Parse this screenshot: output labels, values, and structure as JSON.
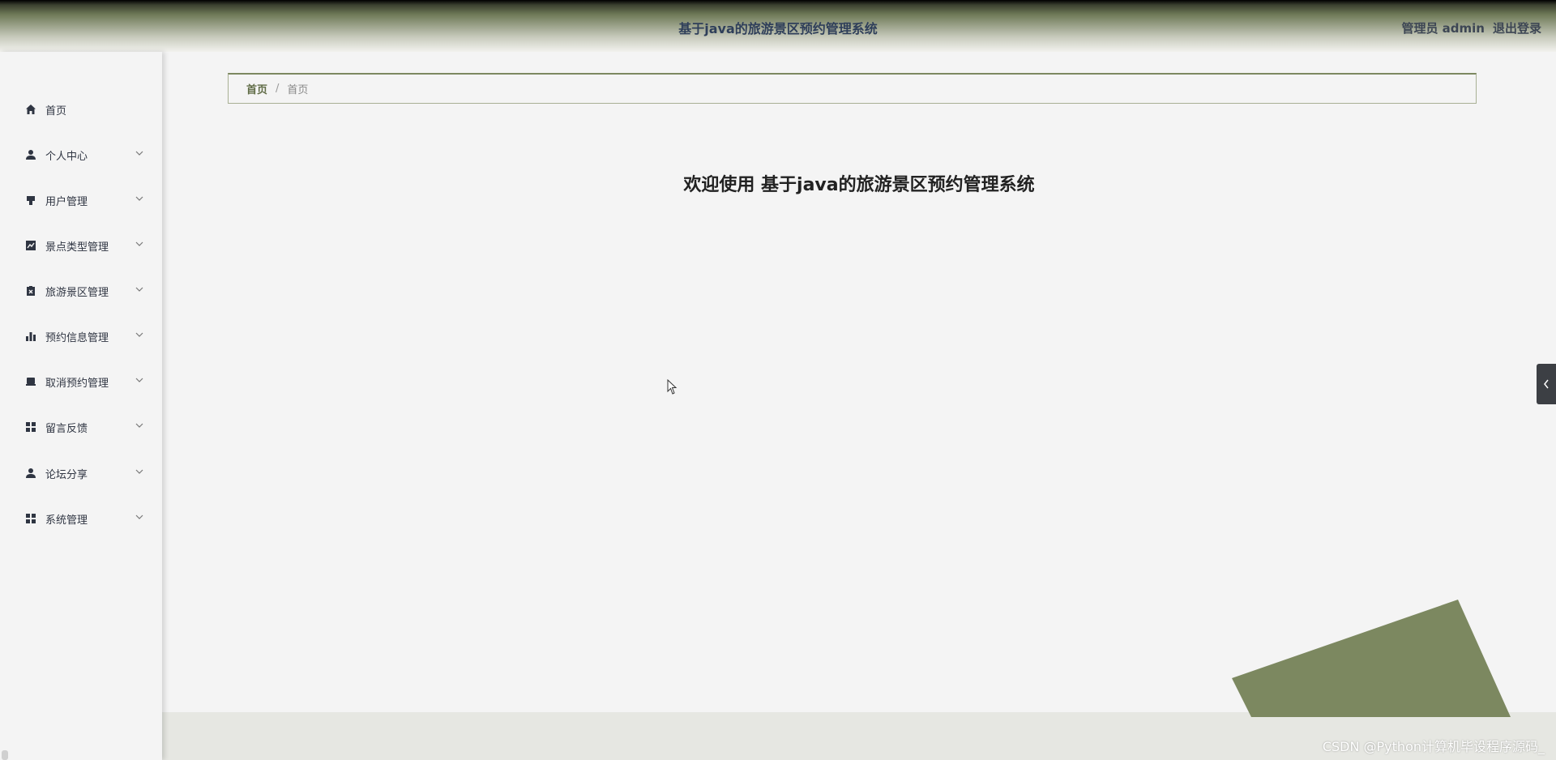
{
  "header": {
    "title": "基于java的旅游景区预约管理系统",
    "role_label": "管理员 admin",
    "logout_label": "退出登录"
  },
  "sidebar": {
    "items": [
      {
        "label": "首页",
        "icon": "home-icon"
      },
      {
        "label": "个人中心",
        "icon": "user-icon"
      },
      {
        "label": "用户管理",
        "icon": "stamp-icon"
      },
      {
        "label": "景点类型管理",
        "icon": "line-chart-icon"
      },
      {
        "label": "旅游景区管理",
        "icon": "clipboard-x-icon"
      },
      {
        "label": "预约信息管理",
        "icon": "bar-chart-icon"
      },
      {
        "label": "取消预约管理",
        "icon": "laptop-icon"
      },
      {
        "label": "留言反馈",
        "icon": "grid-icon"
      },
      {
        "label": "论坛分享",
        "icon": "user-icon"
      },
      {
        "label": "系统管理",
        "icon": "grid-icon"
      }
    ]
  },
  "breadcrumb": {
    "first": "首页",
    "separator": "/",
    "second": "首页"
  },
  "main": {
    "welcome": "欢迎使用 基于java的旅游景区预约管理系统"
  },
  "watermark": "CSDN @Python计算机毕设程序源码_",
  "colors": {
    "accent": "#7c8860",
    "header_text": "#2f3f5a",
    "side_tab": "#3c3f44"
  }
}
